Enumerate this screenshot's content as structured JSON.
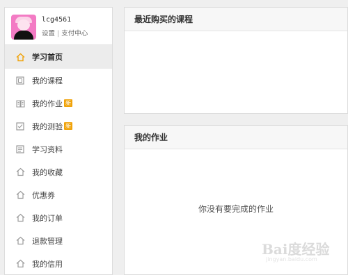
{
  "profile": {
    "username": "lcg4561",
    "settings_link": "设置",
    "separator": "|",
    "payment_link": "支付中心"
  },
  "menu": {
    "items": [
      {
        "label": "学习首页",
        "icon": "home-icon",
        "active": true
      },
      {
        "label": "我的课程",
        "icon": "course-icon"
      },
      {
        "label": "我的作业",
        "icon": "homework-icon",
        "badge": "新"
      },
      {
        "label": "我的测验",
        "icon": "quiz-icon",
        "badge": "新"
      },
      {
        "label": "学习资料",
        "icon": "materials-icon"
      },
      {
        "label": "我的收藏",
        "icon": "home-icon"
      },
      {
        "label": "优惠券",
        "icon": "home-icon"
      },
      {
        "label": "我的订单",
        "icon": "home-icon"
      },
      {
        "label": "退款管理",
        "icon": "home-icon"
      },
      {
        "label": "我的信用",
        "icon": "home-icon"
      }
    ]
  },
  "recent_courses": {
    "title": "最近购买的课程"
  },
  "homework": {
    "title": "我的作业",
    "empty_message": "你没有要完成的作业"
  },
  "watermark": {
    "logo": "Bai度经验",
    "url": "jingyan.baidu.com"
  },
  "colors": {
    "accent_icon": "#f0a30a",
    "badge": "#f0a30a",
    "avatar": "#f37bc4"
  }
}
